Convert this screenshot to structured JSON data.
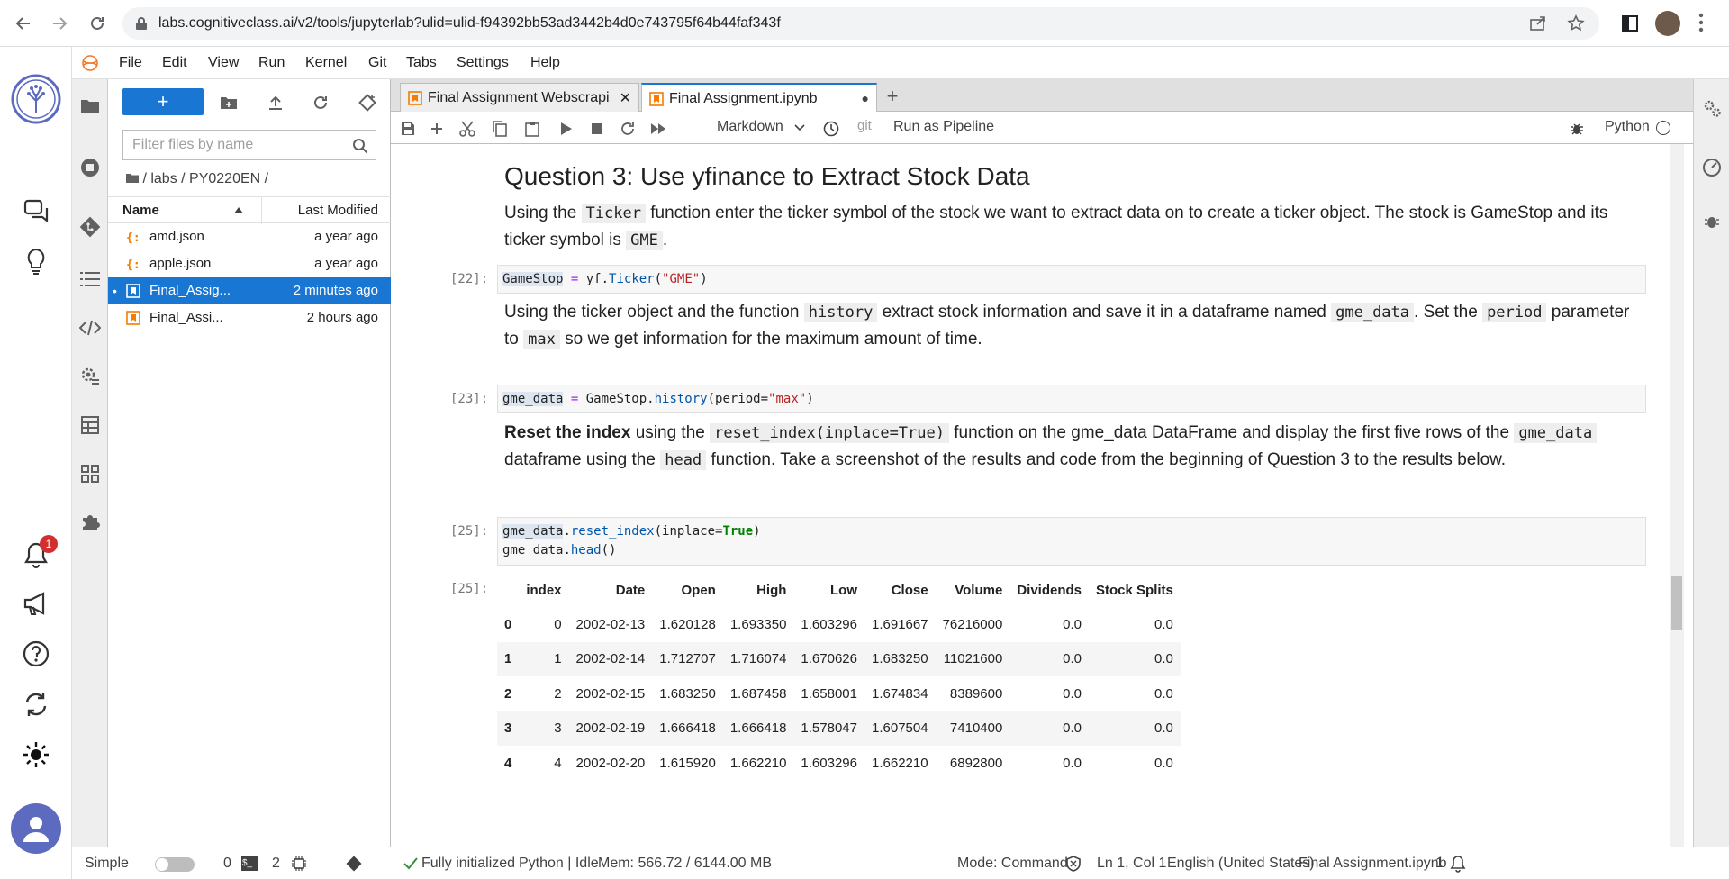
{
  "browser": {
    "url": "labs.cognitiveclass.ai/v2/tools/jupyterlab?ulid=ulid-f94392bb53ad3442b4d0e743795f64b44faf343f"
  },
  "menu": [
    "File",
    "Edit",
    "View",
    "Run",
    "Kernel",
    "Git",
    "Tabs",
    "Settings",
    "Help"
  ],
  "filebrowser": {
    "new_label": "+",
    "filter_placeholder": "Filter files by name",
    "breadcrumb": "/ labs / PY0220EN /",
    "col_name": "Name",
    "col_modified": "Last Modified",
    "files": [
      {
        "name": "amd.json",
        "modified": "a year ago"
      },
      {
        "name": "apple.json",
        "modified": "a year ago"
      },
      {
        "name": "Final_Assig...",
        "modified": "2 minutes ago"
      },
      {
        "name": "Final_Assi...",
        "modified": "2 hours ago"
      }
    ]
  },
  "tabs": [
    {
      "label": "Final Assignment Webscrapi",
      "close": "✕"
    },
    {
      "label": "Final Assignment.ipynb",
      "close": "●"
    }
  ],
  "toolbar": {
    "cell_type": "Markdown",
    "git": "git",
    "pipeline": "Run as Pipeline",
    "kernel": "Python"
  },
  "notebook": {
    "heading": "Question 3: Use yfinance to Extract Stock Data",
    "md1": {
      "pre": "Using the ",
      "c1": "Ticker",
      "mid": " function enter the ticker symbol of the stock we want to extract data on to create a ticker object. The stock is GameStop and its ticker symbol is ",
      "c2": "GME",
      "post": "."
    },
    "cell22": {
      "prompt": "[22]:",
      "var": "GameStop",
      "op": " = ",
      "obj": "yf.",
      "fn": "Ticker",
      "open": "(",
      "str": "\"GME\"",
      "close": ")"
    },
    "md2": {
      "a": "Using the ticker object and the function ",
      "c1": "history",
      "b": " extract stock information and save it in a dataframe named ",
      "c2": "gme_data",
      "c": ". Set the ",
      "c3": "period",
      "d": " parameter to ",
      "c4": "max",
      "e": " so we get information for the maximum amount of time."
    },
    "cell23": {
      "prompt": "[23]:",
      "var": "gme_data",
      "op": " = ",
      "obj": "GameStop.",
      "fn": "history",
      "open": "(period=",
      "str": "\"max\"",
      "close": ")"
    },
    "md3": {
      "bold": "Reset the index",
      "a": " using the ",
      "c1": "reset_index(inplace=True)",
      "b": " function on the gme_data DataFrame and display the first five rows of the ",
      "c2": "gme_data",
      "c": " dataframe using the ",
      "c3": "head",
      "d": " function. Take a screenshot of the results and code from the beginning of Question 3 to the results below."
    },
    "cell25": {
      "prompt": "[25]:",
      "l1_var": "gme_data",
      "l1_dot": ".",
      "l1_fn": "reset_index",
      "l1_open": "(inplace=",
      "l1_kw": "True",
      "l1_close": ")",
      "l2_var": "gme_data",
      "l2_dot": ".",
      "l2_fn": "head",
      "l2_close": "()"
    },
    "out25": {
      "prompt": "[25]:",
      "columns": [
        "",
        "index",
        "Date",
        "Open",
        "High",
        "Low",
        "Close",
        "Volume",
        "Dividends",
        "Stock Splits"
      ],
      "rows": [
        [
          "0",
          "0",
          "2002-02-13",
          "1.620128",
          "1.693350",
          "1.603296",
          "1.691667",
          "76216000",
          "0.0",
          "0.0"
        ],
        [
          "1",
          "1",
          "2002-02-14",
          "1.712707",
          "1.716074",
          "1.670626",
          "1.683250",
          "11021600",
          "0.0",
          "0.0"
        ],
        [
          "2",
          "2",
          "2002-02-15",
          "1.683250",
          "1.687458",
          "1.658001",
          "1.674834",
          "8389600",
          "0.0",
          "0.0"
        ],
        [
          "3",
          "3",
          "2002-02-19",
          "1.666418",
          "1.666418",
          "1.578047",
          "1.607504",
          "7410400",
          "0.0",
          "0.0"
        ],
        [
          "4",
          "4",
          "2002-02-20",
          "1.615920",
          "1.662210",
          "1.603296",
          "1.662210",
          "6892800",
          "0.0",
          "0.0"
        ]
      ]
    }
  },
  "status": {
    "mode_label": "Simple",
    "terminals": "0",
    "kernels": "2",
    "init": "Fully initialized",
    "kernel_state": "Python | Idle",
    "mem": "Mem: 566.72 / 6144.00 MB",
    "cmd_mode": "Mode: Command",
    "cursor": "Ln 1, Col 1",
    "lang": "English (United States)",
    "file": "Final Assignment.ipynb",
    "notif": "1"
  },
  "rail": {
    "badge": "1"
  },
  "colors": {
    "accent": "#1976d2",
    "brand": "#5c6bc0"
  }
}
